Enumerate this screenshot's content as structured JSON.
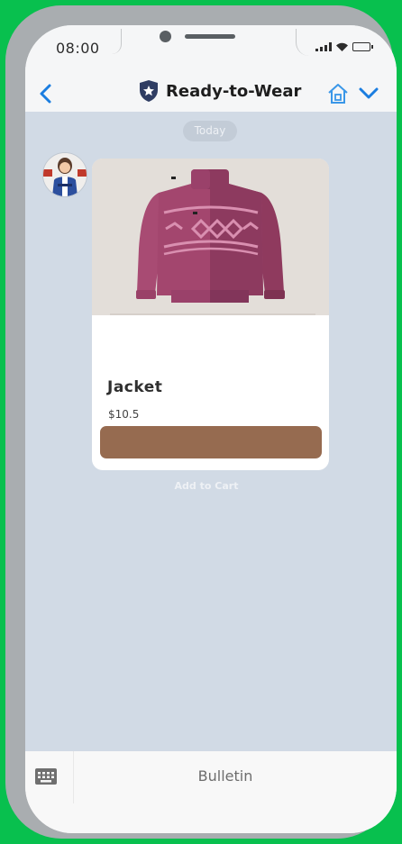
{
  "status_bar": {
    "time": "08:00"
  },
  "header": {
    "title": "Ready-to-Wear"
  },
  "chat": {
    "date_label": "Today",
    "product": {
      "name": "Jacket",
      "price": "$10.5",
      "image_alt": "pink sweater",
      "button_color": "#966b50"
    },
    "add_to_cart_label": "Add to Cart"
  },
  "bottom_bar": {
    "menu_label": "Bulletin"
  }
}
